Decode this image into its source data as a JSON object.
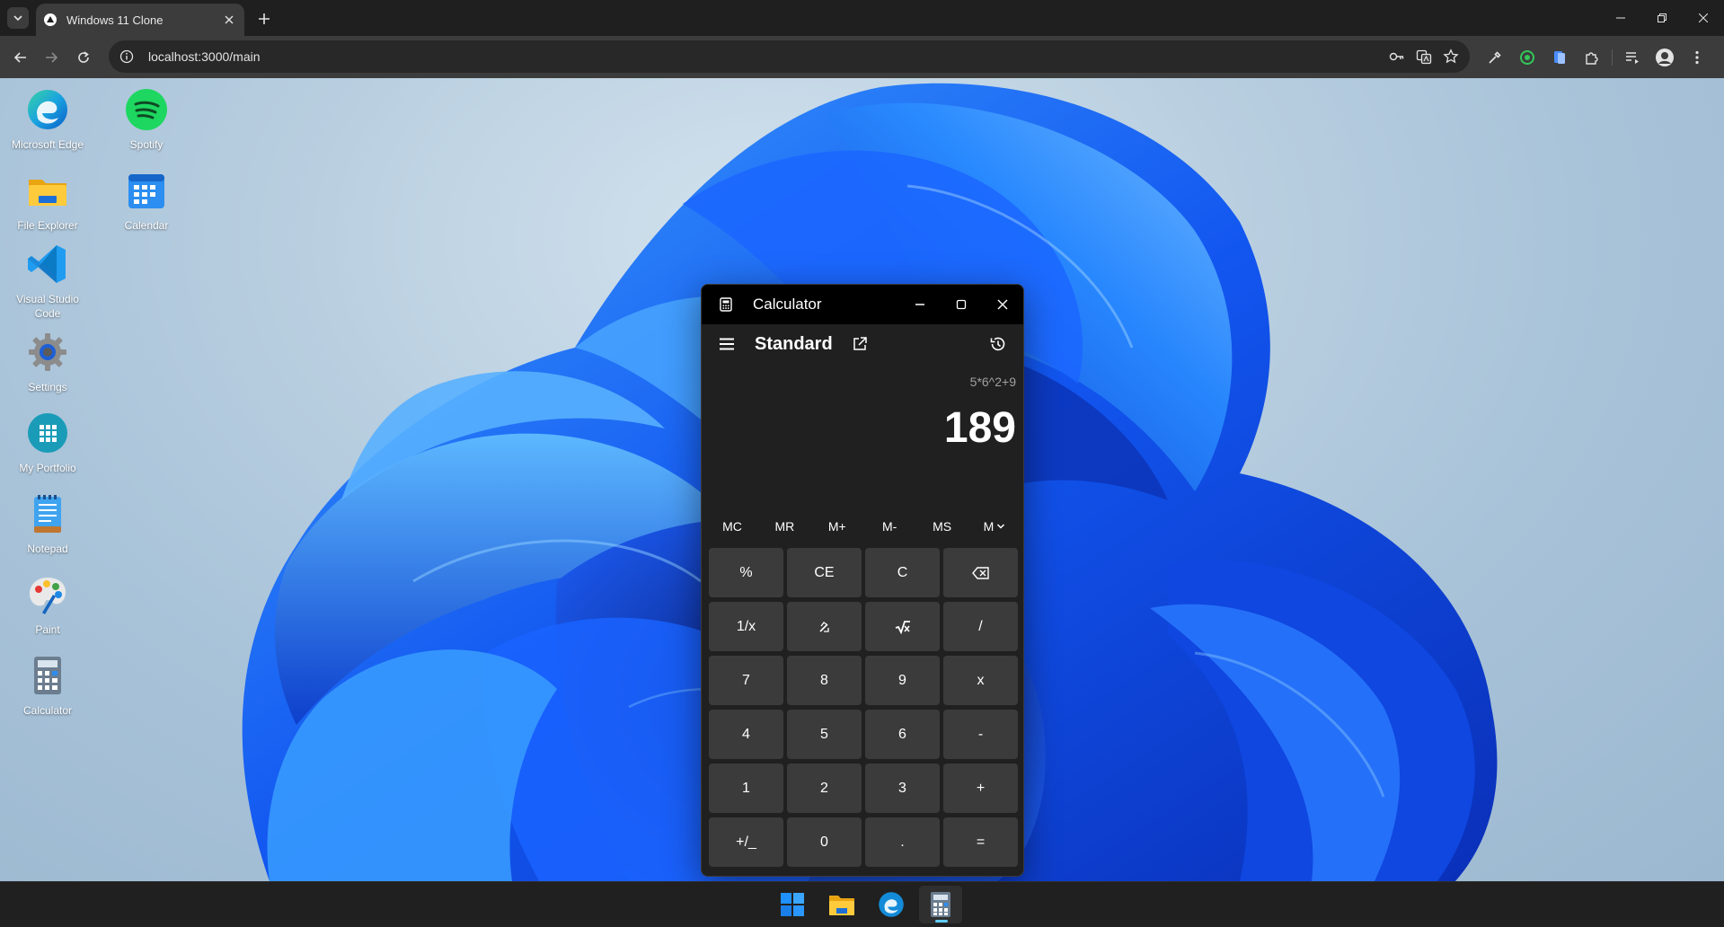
{
  "browser": {
    "tab_title": "Windows 11 Clone",
    "url": "localhost:3000/main"
  },
  "desktop_icons": [
    {
      "label": "Microsoft Edge",
      "icon": "edge-icon"
    },
    {
      "label": "Spotify",
      "icon": "spotify-icon"
    },
    {
      "label": "File Explorer",
      "icon": "folder-icon"
    },
    {
      "label": "Calendar",
      "icon": "calendar-icon"
    },
    {
      "label": "Visual Studio Code",
      "icon": "vscode-icon"
    },
    {
      "label": "Settings",
      "icon": "gear-icon"
    },
    {
      "label": "My Portfolio",
      "icon": "grid-icon"
    },
    {
      "label": "Notepad",
      "icon": "notepad-icon"
    },
    {
      "label": "Paint",
      "icon": "palette-icon"
    },
    {
      "label": "Calculator",
      "icon": "calculator-icon"
    }
  ],
  "calculator": {
    "title": "Calculator",
    "mode": "Standard",
    "expression": "5*6^2+9",
    "result": "189",
    "memory": [
      "MC",
      "MR",
      "M+",
      "M-",
      "MS",
      "M"
    ],
    "keys": [
      "%",
      "CE",
      "C",
      "",
      "1/x",
      "",
      "",
      "/",
      "7",
      "8",
      "9",
      "x",
      "4",
      "5",
      "6",
      "-",
      "1",
      "2",
      "3",
      "+",
      "+/_",
      "0",
      ".",
      "="
    ]
  },
  "colors": {
    "accent": "#60cdff",
    "window_bg": "#202020",
    "key_bg": "#3b3b3b",
    "wallpaper_blue": "#1a5cff"
  }
}
